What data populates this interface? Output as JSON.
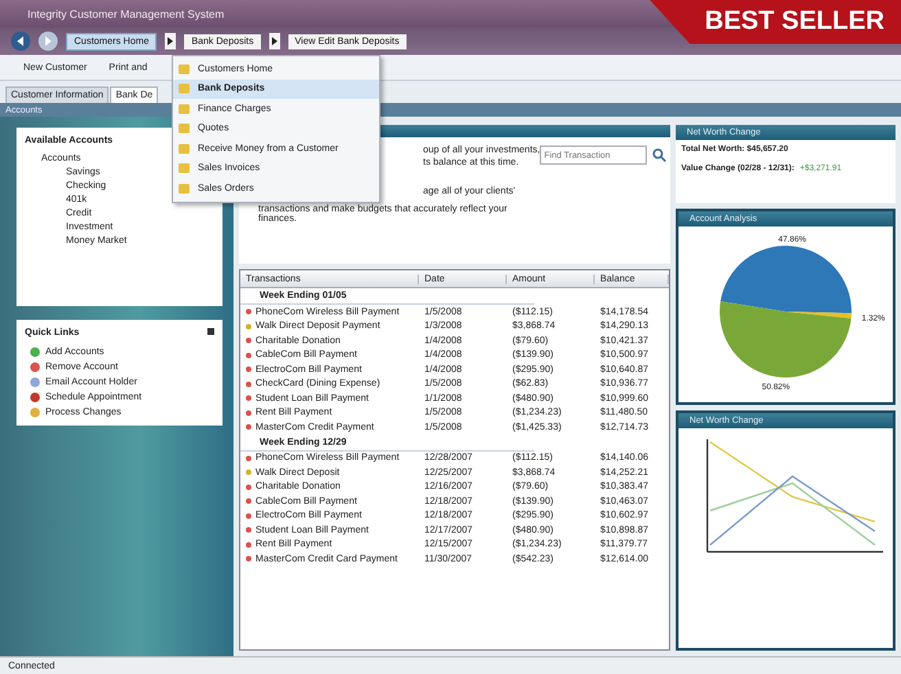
{
  "ribbon": {
    "text": "BEST SELLER"
  },
  "window": {
    "title": "Integrity Customer Management System"
  },
  "breadcrumb": [
    {
      "label": "Customers Home",
      "selected": true
    },
    {
      "label": "Bank Deposits",
      "selected": false
    },
    {
      "label": "View Edit Bank Deposits",
      "selected": false
    }
  ],
  "menu": [
    {
      "label": "Customers Home",
      "selected": false
    },
    {
      "label": "Bank Deposits",
      "selected": true
    },
    {
      "label": "Finance Charges",
      "selected": false
    },
    {
      "label": "Quotes",
      "selected": false
    },
    {
      "label": "Receive Money from a Customer",
      "selected": false
    },
    {
      "label": "Sales Invoices",
      "selected": false
    },
    {
      "label": "Sales Orders",
      "selected": false
    }
  ],
  "toolbar": [
    {
      "label": "New Customer"
    },
    {
      "label": "Print and"
    }
  ],
  "tabs": [
    {
      "label": "Customer Information",
      "selected": false
    },
    {
      "label": "Bank De",
      "selected": true
    }
  ],
  "pane_title": "Accounts",
  "available_accounts": {
    "title": "Available Accounts",
    "items": [
      {
        "label": "Accounts",
        "children": [
          {
            "label": "Savings"
          },
          {
            "label": "Checking"
          },
          {
            "label": "401k"
          },
          {
            "label": "Credit"
          },
          {
            "label": "Investment"
          },
          {
            "label": "Money Market"
          }
        ]
      }
    ]
  },
  "quick_links": {
    "title": "Quick Links",
    "items": [
      {
        "label": "Add Accounts",
        "color": "#4caf50"
      },
      {
        "label": "Remove Account",
        "color": "#d9534f"
      },
      {
        "label": "Email Account Holder",
        "color": "#8fa8d8"
      },
      {
        "label": "Schedule Appointment",
        "color": "#c0392b"
      },
      {
        "label": "Process Changes",
        "color": "#e0b040"
      }
    ]
  },
  "description": [
    "oup of all your investments,",
    "ts balance at this time.",
    "age all of your clients'",
    "transactions and make budgets that accurately reflect your finances."
  ],
  "search": {
    "placeholder": "Find Transaction"
  },
  "table": {
    "columns": [
      "Transactions",
      "Date",
      "Amount",
      "Balance"
    ],
    "groups": [
      {
        "title": "Week Ending 01/05",
        "rows": [
          {
            "cells": [
              "PhoneCom Wireless Bill Payment",
              "1/5/2008",
              "($112.15)",
              "$14,178.54"
            ],
            "color": "#d9534f"
          },
          {
            "cells": [
              "Walk Direct Deposit Payment",
              "1/3/2008",
              "$3,868.74",
              "$14,290.13"
            ],
            "color": "#d4b030"
          },
          {
            "cells": [
              "Charitable Donation",
              "1/4/2008",
              "($79.60)",
              "$10,421.37"
            ],
            "color": "#d9534f"
          },
          {
            "cells": [
              "CableCom Bill Payment",
              "1/4/2008",
              "($139.90)",
              "$10,500.97"
            ],
            "color": "#d9534f"
          },
          {
            "cells": [
              "ElectroCom Bill Payment",
              "1/4/2008",
              "($295.90)",
              "$10,640.87"
            ],
            "color": "#d9534f"
          },
          {
            "cells": [
              "CheckCard (Dining Expense)",
              "1/5/2008",
              "($62.83)",
              "$10,936.77"
            ],
            "color": "#d9534f"
          },
          {
            "cells": [
              "Student Loan Bill Payment",
              "1/1/2008",
              "($480.90)",
              "$10,999.60"
            ],
            "color": "#d9534f"
          },
          {
            "cells": [
              "Rent Bill Payment",
              "1/5/2008",
              "($1,234.23)",
              "$11,480.50"
            ],
            "color": "#d9534f"
          },
          {
            "cells": [
              "MasterCom Credit Payment",
              "1/5/2008",
              "($1,425.33)",
              "$12,714.73"
            ],
            "color": "#d9534f"
          }
        ]
      },
      {
        "title": "Week Ending 12/29",
        "rows": [
          {
            "cells": [
              "PhoneCom Wireless Bill Payment",
              "12/28/2007",
              "($112.15)",
              "$14,140.06"
            ],
            "color": "#d9534f"
          },
          {
            "cells": [
              "Walk Direct Deposit",
              "12/25/2007",
              "$3,868.74",
              "$14,252.21"
            ],
            "color": "#d4b030"
          },
          {
            "cells": [
              "Charitable Donation",
              "12/16/2007",
              "($79.60)",
              "$10,383.47"
            ],
            "color": "#d9534f"
          },
          {
            "cells": [
              "CableCom Bill Payment",
              "12/18/2007",
              "($139.90)",
              "$10,463.07"
            ],
            "color": "#d9534f"
          },
          {
            "cells": [
              "ElectroCom Bill Payment",
              "12/18/2007",
              "($295.90)",
              "$10,602.97"
            ],
            "color": "#d9534f"
          },
          {
            "cells": [
              "Student Loan Bill Payment",
              "12/17/2007",
              "($480.90)",
              "$10,898.87"
            ],
            "color": "#d9534f"
          },
          {
            "cells": [
              "Rent Bill Payment",
              "12/15/2007",
              "($1,234.23)",
              "$11,379.77"
            ],
            "color": "#d9534f"
          },
          {
            "cells": [
              "MasterCom Credit Card Payment",
              "11/30/2007",
              "($542.23)",
              "$12,614.00"
            ],
            "color": "#d9534f"
          }
        ]
      }
    ]
  },
  "net_worth": {
    "title": "Net Worth Change",
    "lines": [
      "Total Net Worth:  $45,657.20",
      "Value Change (02/28 - 12/31):"
    ],
    "change": "+$3,271.91"
  },
  "analysis": {
    "title": "Account Analysis",
    "chart_data": {
      "type": "pie",
      "values": [
        47.86,
        1.32,
        50.82
      ],
      "value_labels": [
        "47.86%",
        "1.32%",
        "50.82%"
      ]
    }
  },
  "trend": {
    "title": "Net Worth Change"
  },
  "status_bar": {
    "text": "Connected"
  }
}
